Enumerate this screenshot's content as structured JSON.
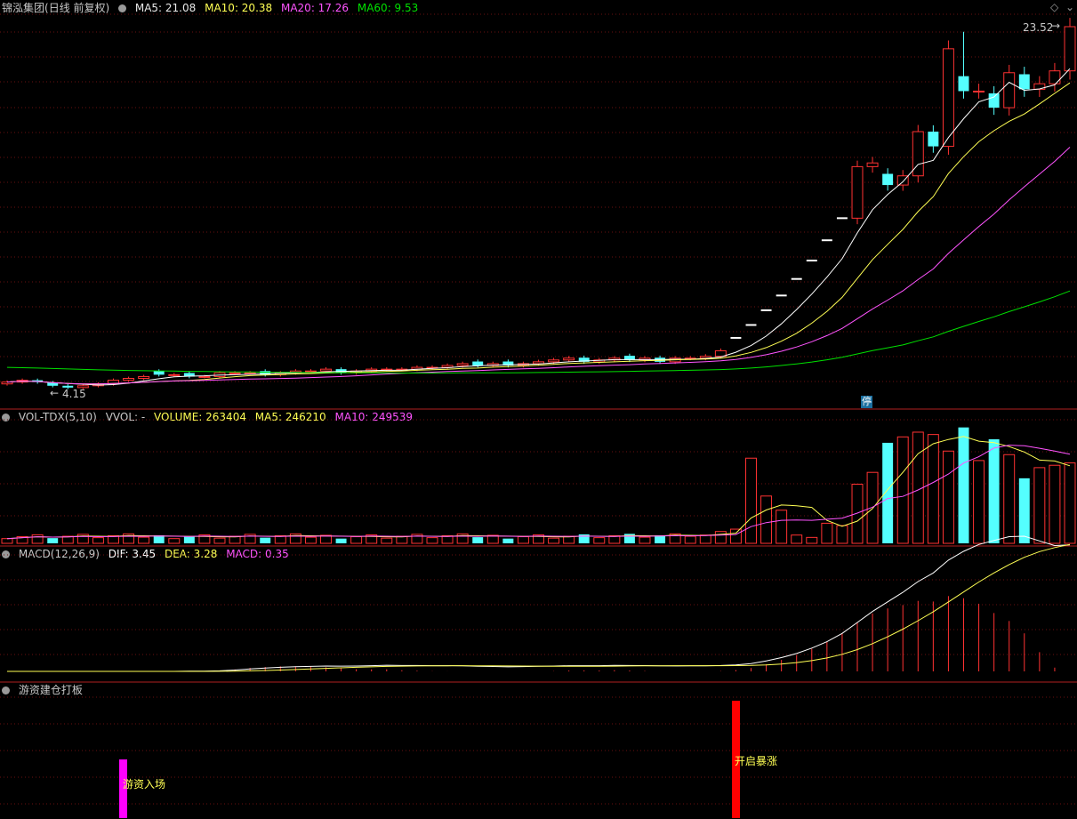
{
  "stock": {
    "name": "锦泓集团",
    "period": "(日线 前复权)"
  },
  "main": {
    "ma5_label": "MA5: 21.08",
    "ma10_label": "MA10: 20.38",
    "ma20_label": "MA20: 17.26",
    "ma60_label": "MA60: 9.53",
    "high_label": "23.52",
    "low_label": "4.15",
    "halt_label": "停",
    "colors": {
      "up": "#ff3232",
      "down": "#54ffff",
      "ma5": "#ffffff",
      "ma10": "#ffff54",
      "ma20": "#ff54ff",
      "ma60": "#00e000"
    }
  },
  "volume": {
    "title": "VOL-TDX(5,10)",
    "vvol": "VVOL: -",
    "volume_label": "VOLUME: 263404",
    "ma5_label": "MA5: 246210",
    "ma10_label": "MA10: 249539"
  },
  "macd": {
    "title": "MACD(12,26,9)",
    "dif_label": "DIF: 3.45",
    "dea_label": "DEA: 3.28",
    "macd_label": "MACD: 0.35"
  },
  "signal": {
    "title": "游资建仓打板",
    "entry_label": "游资入场",
    "surge_label": "开启暴涨"
  },
  "top_icons": [
    "diamond-icon",
    "chevron-down-icon"
  ],
  "chart_data": {
    "type": "candlestick",
    "price_high": 23.52,
    "price_low": 4.15,
    "closes": [
      4.5,
      4.6,
      4.5,
      4.3,
      4.2,
      4.3,
      4.4,
      4.6,
      4.7,
      4.8,
      4.9,
      4.9,
      4.8,
      4.8,
      5.0,
      5.0,
      5.0,
      4.9,
      5.0,
      5.1,
      5.1,
      5.2,
      5.0,
      5.1,
      5.2,
      5.2,
      5.2,
      5.3,
      5.3,
      5.4,
      5.5,
      5.4,
      5.5,
      5.4,
      5.5,
      5.6,
      5.7,
      5.8,
      5.6,
      5.7,
      5.8,
      5.7,
      5.8,
      5.6,
      5.8,
      5.8,
      5.9,
      6.2,
      6.9,
      7.6,
      8.4,
      9.2,
      10.1,
      11.1,
      12.2,
      13.4,
      16.2,
      16.4,
      15.2,
      15.7,
      18.1,
      17.3,
      22.6,
      20.3,
      20.3,
      19.4,
      21.3,
      20.4,
      20.7,
      21.4,
      23.8
    ],
    "volume": {
      "ma5": 246210,
      "ma10": 249539,
      "last": 263404
    },
    "macd": {
      "dif": 3.45,
      "dea": 3.28,
      "macd": 0.35
    }
  }
}
